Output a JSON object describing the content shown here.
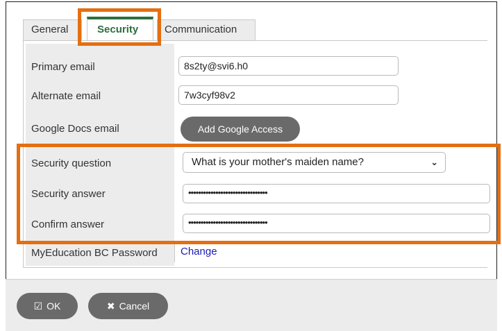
{
  "tabs": {
    "general": "General",
    "security": "Security",
    "communication": "Communication"
  },
  "fields": {
    "primary_email": {
      "label": "Primary email",
      "value": "8s2ty@svi6.h0"
    },
    "alternate_email": {
      "label": "Alternate email",
      "value": "7w3cyf98v2"
    },
    "google_docs": {
      "label": "Google Docs email",
      "button": "Add Google Access"
    },
    "security_question": {
      "label": "Security question",
      "value": "What is your mother's maiden name?"
    },
    "security_answer": {
      "label": "Security answer",
      "value": "••••••••••••••••••••••••••••••••"
    },
    "confirm_answer": {
      "label": "Confirm answer",
      "value": "••••••••••••••••••••••••••••••••"
    },
    "myed_password": {
      "label": "MyEducation BC Password",
      "link": "Change"
    }
  },
  "footer": {
    "ok_label": "OK",
    "cancel_label": "Cancel"
  },
  "icons": {
    "ok": "check-square-icon",
    "cancel": "x-icon",
    "dropdown": "chevron-down-icon"
  },
  "colors": {
    "highlight": "#e36f12",
    "active_tab": "#2e6e3c",
    "button": "#6a6a6a",
    "link": "#1a1ab8"
  }
}
